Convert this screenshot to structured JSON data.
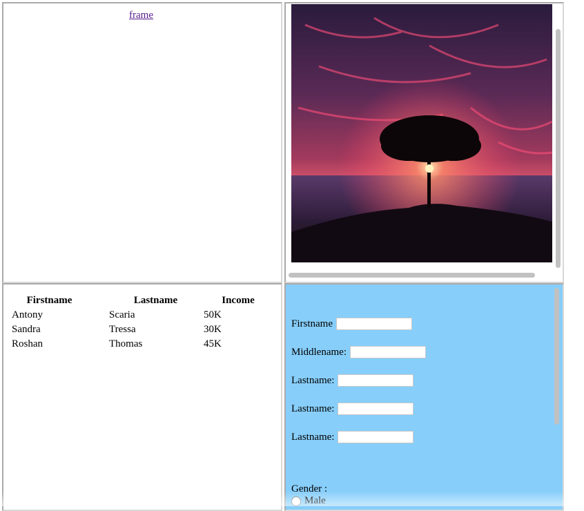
{
  "frame1": {
    "link_text": "frame"
  },
  "frame2": {
    "image_label": "sunset-tree-image"
  },
  "table": {
    "headers": [
      "Firstname",
      "Lastname",
      "Income"
    ],
    "rows": [
      [
        "Antony",
        "Scaria",
        "50K"
      ],
      [
        "Sandra",
        "Tressa",
        "30K"
      ],
      [
        "Roshan",
        "Thomas",
        "45K"
      ]
    ]
  },
  "form": {
    "fields": [
      {
        "label": "Firstname",
        "value": ""
      },
      {
        "label": "Middlename:",
        "value": ""
      },
      {
        "label": "Lastname:",
        "value": ""
      },
      {
        "label": "Lastname:",
        "value": ""
      },
      {
        "label": "Lastname:",
        "value": ""
      }
    ],
    "gender_label": "Gender :",
    "gender_options": [
      "Male"
    ]
  },
  "colors": {
    "form_background": "#87cefa",
    "link": "#551a8b"
  }
}
